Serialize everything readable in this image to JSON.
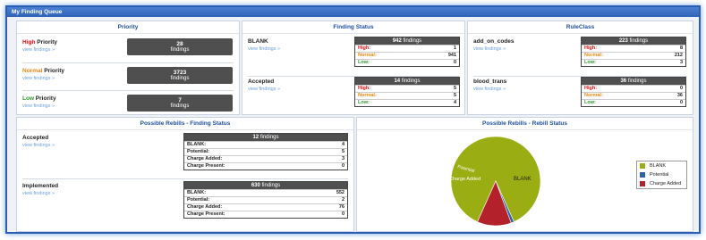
{
  "window": {
    "title": "My Finding Queue"
  },
  "priority": {
    "title": "Priority",
    "view_link": "view findings »",
    "high": {
      "word": "High",
      "suffix": " Priority",
      "count": "28",
      "unit": "findings"
    },
    "normal": {
      "word": "Normal",
      "suffix": " Priority",
      "count": "3723",
      "unit": "findings"
    },
    "low": {
      "word": "Low",
      "suffix": " Priority",
      "count": "7",
      "unit": "findings"
    }
  },
  "finding_status": {
    "title": "Finding Status",
    "view_link": "view findings »",
    "items": [
      {
        "name": "BLANK",
        "total": "942",
        "unit": "findings",
        "high": "1",
        "normal": "941",
        "low": "0"
      },
      {
        "name": "Accepted",
        "total": "14",
        "unit": "findings",
        "high": "5",
        "normal": "5",
        "low": "4"
      }
    ],
    "labels": {
      "high": "High:",
      "normal": "Normal:",
      "low": "Low:"
    }
  },
  "rule_class": {
    "title": "RuleClass",
    "view_link": "view findings »",
    "items": [
      {
        "name": "add_on_codes",
        "total": "223",
        "unit": "findings",
        "high": "8",
        "normal": "212",
        "low": "3"
      },
      {
        "name": "blood_trans",
        "total": "36",
        "unit": "findings",
        "high": "0",
        "normal": "36",
        "low": "0"
      }
    ],
    "labels": {
      "high": "High:",
      "normal": "Normal:",
      "low": "Low:"
    }
  },
  "rebills_finding_status": {
    "title": "Possible Rebills - Finding Status",
    "view_link": "view findings »",
    "items": [
      {
        "name": "Accepted",
        "total": "12",
        "unit": "findings",
        "blank": "4",
        "potential": "5",
        "charge_added": "3",
        "charge_present": "0"
      },
      {
        "name": "Implemented",
        "total": "630",
        "unit": "findings",
        "blank": "552",
        "potential": "2",
        "charge_added": "76",
        "charge_present": "0"
      }
    ],
    "labels": {
      "blank": "BLANK:",
      "potential": "Potential:",
      "charge_added": "Charge Added:",
      "charge_present": "Charge Present:"
    }
  },
  "rebill_status_chart": {
    "title": "Possible Rebills - Rebill Status",
    "slice_labels": {
      "blank": "BLANK",
      "potential": "Potential",
      "charge_added": "Charge Added"
    },
    "legend": [
      "BLANK",
      "Potential",
      "Charge Added"
    ]
  },
  "colors": {
    "blank": "#9aad12",
    "potential": "#2a62a8",
    "charge_added": "#b3222b",
    "accent": "#1f4e9c"
  },
  "chart_data": {
    "type": "pie",
    "title": "Possible Rebills - Rebill Status",
    "categories": [
      "BLANK",
      "Potential",
      "Charge Added"
    ],
    "values": [
      556,
      7,
      79
    ],
    "legend_position": "right"
  }
}
